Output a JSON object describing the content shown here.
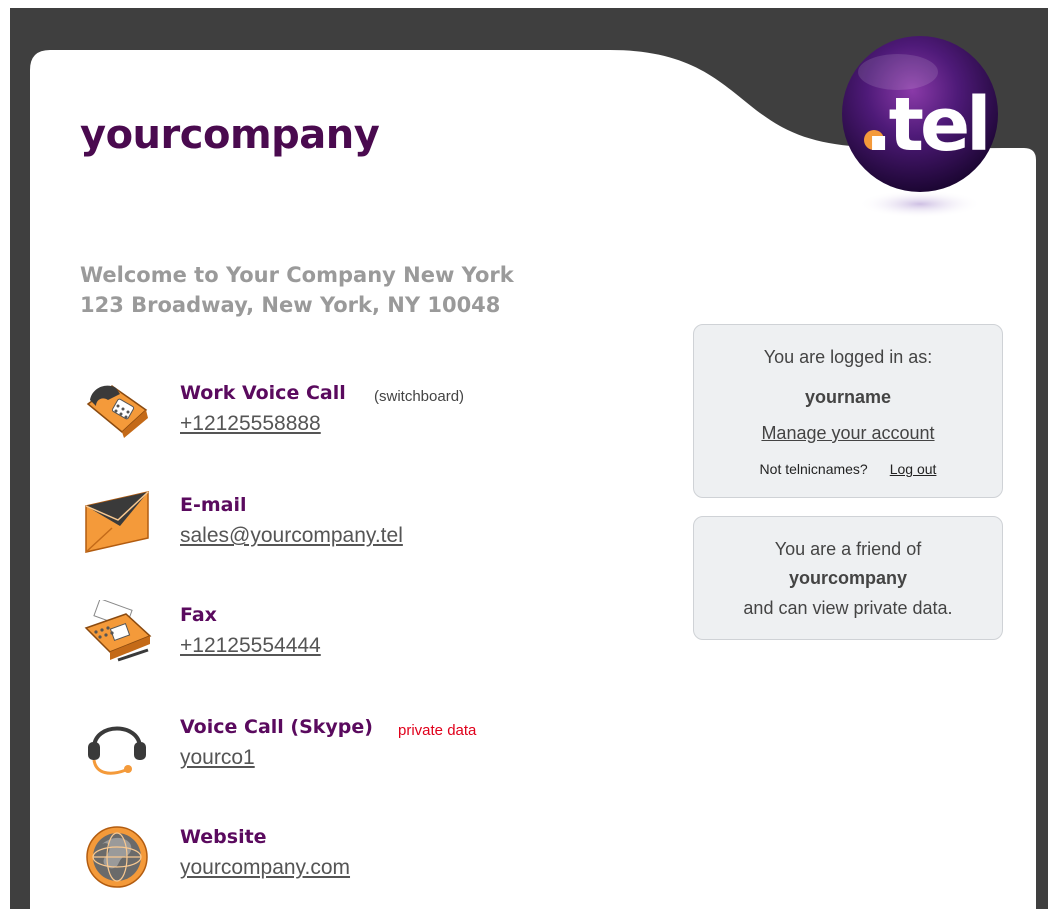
{
  "header": {
    "brand": "yourcompany",
    "logo_text": ".tel"
  },
  "welcome": {
    "line1": "Welcome to Your Company New York",
    "line2": "123 Broadway, New York, NY 10048"
  },
  "contacts": [
    {
      "icon": "phone-icon",
      "label": "Work Voice Call",
      "note": "(switchboard)",
      "note_color": "#444444",
      "value": "+12125558888"
    },
    {
      "icon": "envelope-icon",
      "label": "E-mail",
      "note": "",
      "value": "sales@yourcompany.tel"
    },
    {
      "icon": "fax-icon",
      "label": "Fax",
      "note": "",
      "value": "+12125554444"
    },
    {
      "icon": "headset-icon",
      "label": "Voice Call (Skype)",
      "note": "private data",
      "note_color": "#e0001b",
      "value": "yourco1"
    },
    {
      "icon": "globe-icon",
      "label": "Website",
      "note": "",
      "value": "yourcompany.com"
    }
  ],
  "login_box": {
    "title": "You are logged in as:",
    "username": "yourname",
    "manage_link": "Manage your account",
    "not_user_text": "Not telnicnames?",
    "logout_link": "Log out"
  },
  "friend_box": {
    "line1": "You are a friend of",
    "company": "yourcompany",
    "line3": "and can view private data."
  },
  "colors": {
    "brand": "#4a0a4f",
    "label": "#5a0a5e",
    "accent_orange": "#f49a3a",
    "frame": "#3f3f3f",
    "private": "#e0001b"
  }
}
